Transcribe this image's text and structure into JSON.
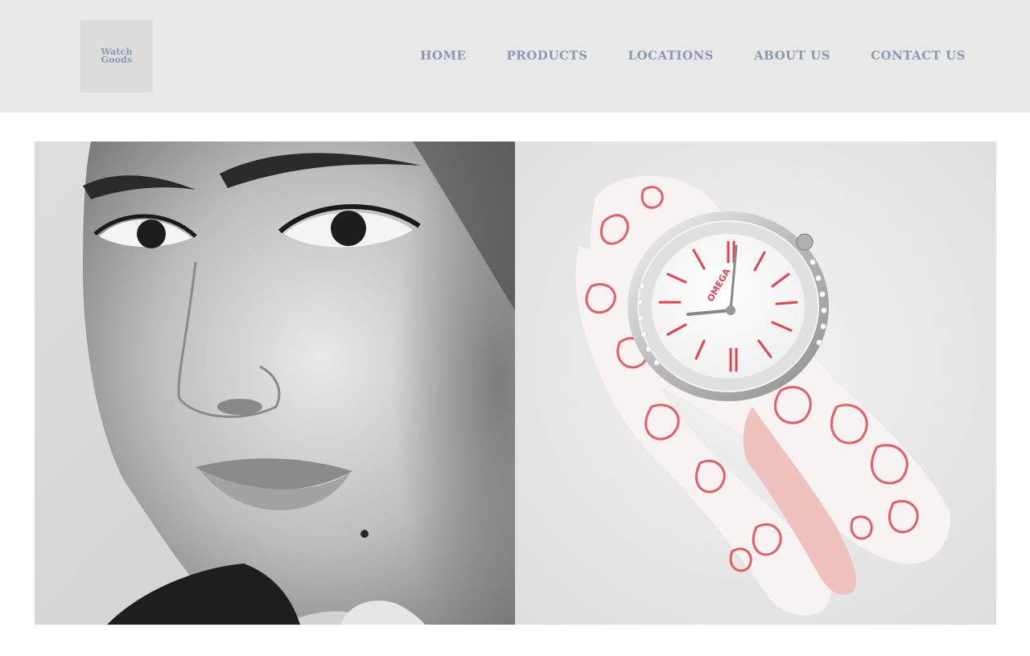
{
  "brand": {
    "logo_text": "Watch\nGoods",
    "logo_color": "#8e9aac",
    "header_bg": "#e8e8e9",
    "nav_color": "#8a99b2"
  },
  "nav": {
    "items": [
      {
        "label": "HOME"
      },
      {
        "label": "PRODUCTS"
      },
      {
        "label": "LOCATIONS"
      },
      {
        "label": "ABOUT US"
      },
      {
        "label": "CONTACT US"
      }
    ]
  },
  "hero": {
    "left_image": "portrait-photo",
    "right_image": "watch-photo",
    "watch_brand": "OMEGA",
    "accent_color": "#e2434f"
  }
}
